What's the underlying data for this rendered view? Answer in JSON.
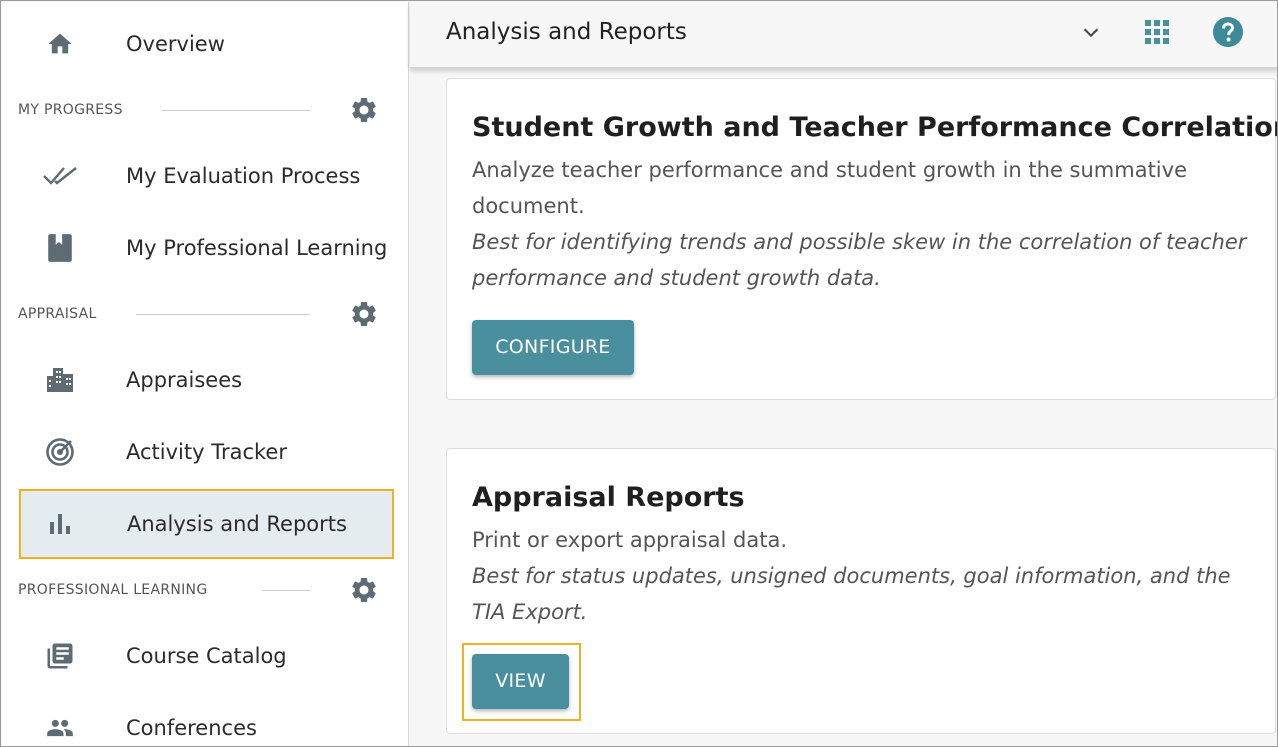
{
  "sidebar": {
    "overview_label": "Overview",
    "sections": {
      "my_progress": "MY PROGRESS",
      "appraisal": "APPRAISAL",
      "professional_learning": "PROFESSIONAL LEARNING"
    },
    "items": {
      "my_evaluation_process": "My Evaluation Process",
      "my_professional_learning": "My Professional Learning",
      "appraisees": "Appraisees",
      "activity_tracker": "Activity Tracker",
      "analysis_and_reports": "Analysis and Reports",
      "course_catalog": "Course Catalog",
      "conferences": "Conferences"
    },
    "active_item": "Analysis and Reports"
  },
  "header": {
    "title": "Analysis and Reports",
    "icons": [
      "chevron-down-icon",
      "apps-grid-icon",
      "help-icon"
    ]
  },
  "cards": [
    {
      "title": "Student Growth and Teacher Performance Correlation",
      "description": "Analyze teacher performance and student growth in the summative document.",
      "note": "Best for identifying trends and possible skew in the correlation of teacher performance and student growth data.",
      "button_label": "CONFIGURE"
    },
    {
      "title": "Appraisal Reports",
      "description": "Print or export appraisal data.",
      "note": "Best for status updates, unsigned documents, goal information, and the TIA Export.",
      "button_label": "VIEW"
    }
  ],
  "colors": {
    "accent": "#4a8f9e",
    "highlight": "#f1b022",
    "active_bg": "#e4ecef",
    "icon_gray": "#5f6b73",
    "help_icon": "#3d8a98"
  }
}
